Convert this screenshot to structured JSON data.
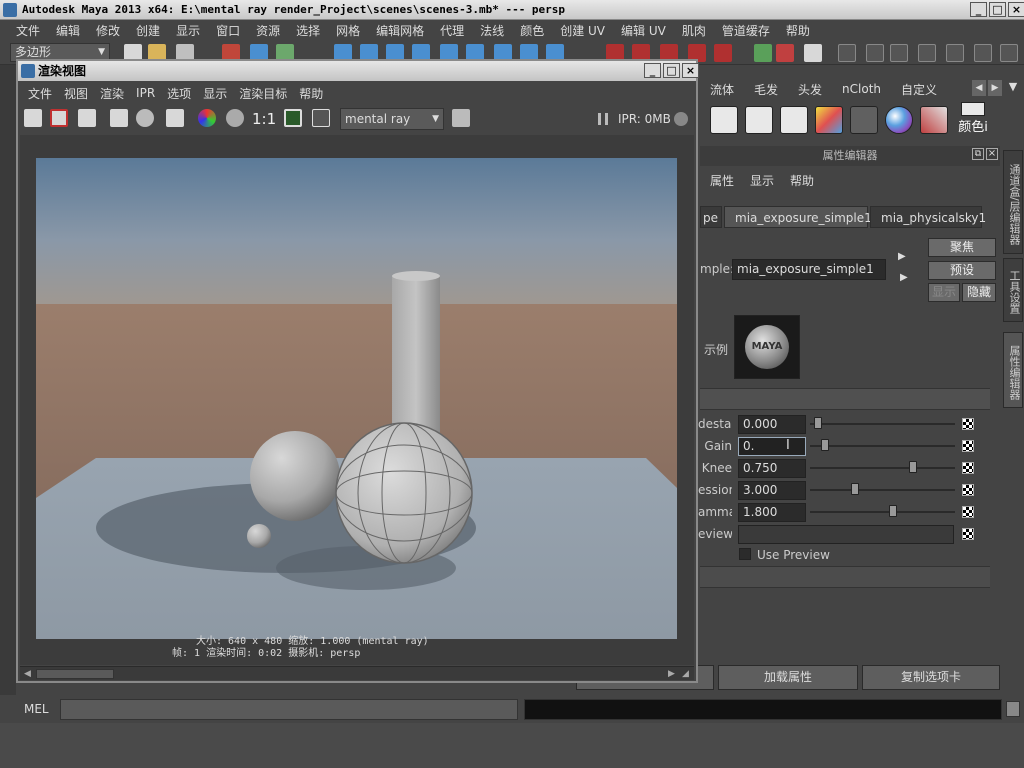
{
  "app": {
    "title": "Autodesk Maya 2013 x64: E:\\mental ray render_Project\\scenes\\scenes-3.mb*   ---   persp",
    "window_buttons": [
      "_",
      "□",
      "×"
    ]
  },
  "main_menu": [
    "文件",
    "编辑",
    "修改",
    "创建",
    "显示",
    "窗口",
    "资源",
    "选择",
    "网格",
    "编辑网格",
    "代理",
    "法线",
    "颜色",
    "创建 UV",
    "编辑 UV",
    "肌肉",
    "管道缓存",
    "帮助"
  ],
  "status_line": {
    "mode_select": "多边形"
  },
  "shelf": {
    "tabs": [
      "流体",
      "毛发",
      "头发",
      "nCloth",
      "自定义"
    ],
    "color_label": "颜色i"
  },
  "render_view": {
    "title": "渲染视图",
    "menu": [
      "文件",
      "视图",
      "渲染",
      "IPR",
      "选项",
      "显示",
      "渲染目标",
      "帮助"
    ],
    "zoom_label": "1:1",
    "renderer": "mental ray",
    "ipr_status": "IPR: 0MB",
    "info_line1": "大小: 640 x 480 缩放: 1.000          (mental ray)",
    "info_line2": "帧: 1          渲染时间: 0:02          摄影机: persp"
  },
  "attribute_editor": {
    "header": "属性编辑器",
    "menu": [
      "属性",
      "显示",
      "帮助"
    ],
    "tabs": [
      "pe",
      "mia_exposure_simple1",
      "mia_physicalsky1"
    ],
    "node_label": "mple:",
    "node_name": "mia_exposure_simple1",
    "buttons": {
      "focus": "聚焦",
      "presets": "预设",
      "show": "显示",
      "hide": "隐藏"
    },
    "sample_label": "示例",
    "sample_logo": "MAYA",
    "attributes": [
      {
        "label": "destal",
        "value": "0.000",
        "slider": 0.03
      },
      {
        "label": "Gain",
        "value": "0.",
        "slider": 0.08
      },
      {
        "label": "Knee",
        "value": "0.750",
        "slider": 0.72
      },
      {
        "label": "ession",
        "value": "3.000",
        "slider": 0.3
      },
      {
        "label": "amma",
        "value": "1.800",
        "slider": 0.58
      },
      {
        "label": "eview",
        "value": "",
        "slider": null
      }
    ],
    "use_preview": "Use Preview",
    "load_attributes": "加载属性",
    "copy_tab": "复制选项卡"
  },
  "side_tabs": [
    "通道盒/层编辑器",
    "工具设置",
    "属性编辑器"
  ],
  "command_line": {
    "label": "MEL"
  }
}
